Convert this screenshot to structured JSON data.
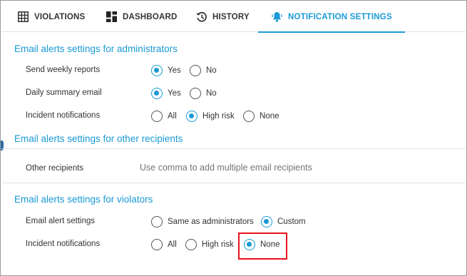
{
  "tabs": [
    {
      "label": "VIOLATIONS",
      "icon": "grid-icon",
      "active": false
    },
    {
      "label": "DASHBOARD",
      "icon": "dashboard-icon",
      "active": false
    },
    {
      "label": "HISTORY",
      "icon": "history-icon",
      "active": false
    },
    {
      "label": "NOTIFICATION SETTINGS",
      "icon": "bell-icon",
      "active": true
    }
  ],
  "accent_color": "#1a9ad6",
  "highlight_color": "#e8121b",
  "admin": {
    "title": "Email alerts settings for administrators",
    "weekly": {
      "label": "Send weekly reports",
      "options": [
        "Yes",
        "No"
      ],
      "selected": "Yes"
    },
    "daily": {
      "label": "Daily summary email",
      "options": [
        "Yes",
        "No"
      ],
      "selected": "Yes"
    },
    "incident": {
      "label": "Incident notifications",
      "options": [
        "All",
        "High risk",
        "None"
      ],
      "selected": "High risk"
    }
  },
  "other": {
    "title": "Email alerts settings for other recipients",
    "recipients_label": "Other recipients",
    "recipients_placeholder": "Use comma to add multiple email recipients",
    "recipients_value": ""
  },
  "violators": {
    "title": "Email alerts settings for violators",
    "alert": {
      "label": "Email alert settings",
      "options": [
        "Same as administrators",
        "Custom"
      ],
      "selected": "Custom"
    },
    "incident": {
      "label": "Incident notifications",
      "options": [
        "All",
        "High risk",
        "None"
      ],
      "selected": "None"
    }
  }
}
